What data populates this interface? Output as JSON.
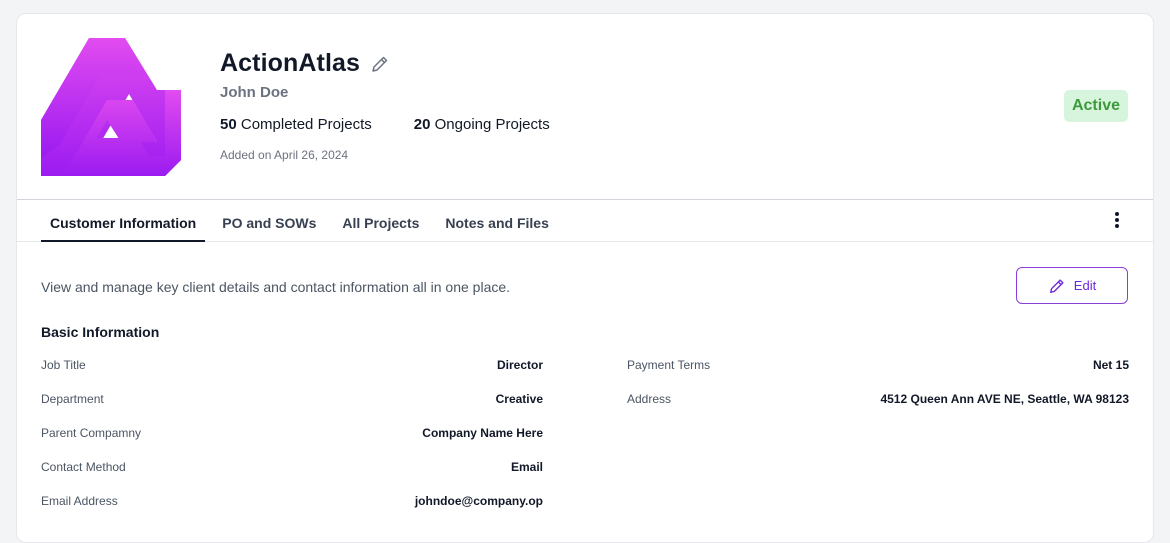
{
  "header": {
    "company_name": "ActionAtlas",
    "contact_name": "John Doe",
    "completed_count": "50",
    "completed_label": "Completed Projects",
    "ongoing_count": "20",
    "ongoing_label": "Ongoing Projects",
    "added_on": "Added on April 26, 2024",
    "status": "Active",
    "logo_colors": {
      "top": "#e24cf0",
      "bottom": "#9b1bf0"
    },
    "status_colors": {
      "bg": "#d7f5dc",
      "text": "#3c9a3c"
    }
  },
  "tabs": [
    {
      "label": "Customer Information",
      "active": true
    },
    {
      "label": "PO and SOWs",
      "active": false
    },
    {
      "label": "All Projects",
      "active": false
    },
    {
      "label": "Notes and Files",
      "active": false
    }
  ],
  "content": {
    "description": "View and manage key client details and contact information all in one place.",
    "edit_label": "Edit",
    "section_title": "Basic Information",
    "left_fields": [
      {
        "label": "Job Title",
        "value": "Director"
      },
      {
        "label": "Department",
        "value": "Creative"
      },
      {
        "label": "Parent Compamny",
        "value": "Company Name Here"
      },
      {
        "label": "Contact Method",
        "value": "Email"
      },
      {
        "label": "Email Address",
        "value": "johndoe@company.op"
      }
    ],
    "right_fields": [
      {
        "label": "Payment Terms",
        "value": "Net 15"
      },
      {
        "label": "Address",
        "value": "4512 Queen Ann AVE NE, Seattle, WA 98123"
      }
    ]
  },
  "icons": {
    "logo": "company-logo",
    "edit_name": "pencil-icon",
    "kebab": "more-vertical-icon",
    "edit_button": "pencil-icon"
  },
  "accent_color": "#8b3fd9"
}
